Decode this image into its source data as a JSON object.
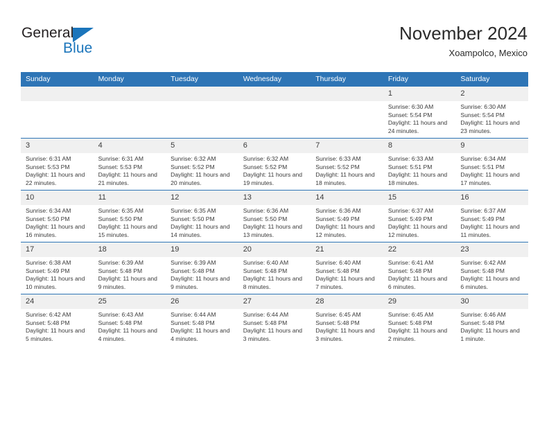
{
  "brand": {
    "name_top": "General",
    "name_bottom": "Blue",
    "accent_color": "#1b75bb"
  },
  "header": {
    "title": "November 2024",
    "subtitle": "Xoampolco, Mexico"
  },
  "theme": {
    "header_blue": "#2e75b6",
    "daynum_band": "#f0f0f0",
    "text": "#3b3b3b"
  },
  "calendar": {
    "weekday_headers": [
      "Sunday",
      "Monday",
      "Tuesday",
      "Wednesday",
      "Thursday",
      "Friday",
      "Saturday"
    ],
    "weeks": [
      [
        {
          "day": "",
          "empty": true
        },
        {
          "day": "",
          "empty": true
        },
        {
          "day": "",
          "empty": true
        },
        {
          "day": "",
          "empty": true
        },
        {
          "day": "",
          "empty": true
        },
        {
          "day": "1",
          "sunrise": "Sunrise: 6:30 AM",
          "sunset": "Sunset: 5:54 PM",
          "daylight": "Daylight: 11 hours and 24 minutes."
        },
        {
          "day": "2",
          "sunrise": "Sunrise: 6:30 AM",
          "sunset": "Sunset: 5:54 PM",
          "daylight": "Daylight: 11 hours and 23 minutes."
        }
      ],
      [
        {
          "day": "3",
          "sunrise": "Sunrise: 6:31 AM",
          "sunset": "Sunset: 5:53 PM",
          "daylight": "Daylight: 11 hours and 22 minutes."
        },
        {
          "day": "4",
          "sunrise": "Sunrise: 6:31 AM",
          "sunset": "Sunset: 5:53 PM",
          "daylight": "Daylight: 11 hours and 21 minutes."
        },
        {
          "day": "5",
          "sunrise": "Sunrise: 6:32 AM",
          "sunset": "Sunset: 5:52 PM",
          "daylight": "Daylight: 11 hours and 20 minutes."
        },
        {
          "day": "6",
          "sunrise": "Sunrise: 6:32 AM",
          "sunset": "Sunset: 5:52 PM",
          "daylight": "Daylight: 11 hours and 19 minutes."
        },
        {
          "day": "7",
          "sunrise": "Sunrise: 6:33 AM",
          "sunset": "Sunset: 5:52 PM",
          "daylight": "Daylight: 11 hours and 18 minutes."
        },
        {
          "day": "8",
          "sunrise": "Sunrise: 6:33 AM",
          "sunset": "Sunset: 5:51 PM",
          "daylight": "Daylight: 11 hours and 18 minutes."
        },
        {
          "day": "9",
          "sunrise": "Sunrise: 6:34 AM",
          "sunset": "Sunset: 5:51 PM",
          "daylight": "Daylight: 11 hours and 17 minutes."
        }
      ],
      [
        {
          "day": "10",
          "sunrise": "Sunrise: 6:34 AM",
          "sunset": "Sunset: 5:50 PM",
          "daylight": "Daylight: 11 hours and 16 minutes."
        },
        {
          "day": "11",
          "sunrise": "Sunrise: 6:35 AM",
          "sunset": "Sunset: 5:50 PM",
          "daylight": "Daylight: 11 hours and 15 minutes."
        },
        {
          "day": "12",
          "sunrise": "Sunrise: 6:35 AM",
          "sunset": "Sunset: 5:50 PM",
          "daylight": "Daylight: 11 hours and 14 minutes."
        },
        {
          "day": "13",
          "sunrise": "Sunrise: 6:36 AM",
          "sunset": "Sunset: 5:50 PM",
          "daylight": "Daylight: 11 hours and 13 minutes."
        },
        {
          "day": "14",
          "sunrise": "Sunrise: 6:36 AM",
          "sunset": "Sunset: 5:49 PM",
          "daylight": "Daylight: 11 hours and 12 minutes."
        },
        {
          "day": "15",
          "sunrise": "Sunrise: 6:37 AM",
          "sunset": "Sunset: 5:49 PM",
          "daylight": "Daylight: 11 hours and 12 minutes."
        },
        {
          "day": "16",
          "sunrise": "Sunrise: 6:37 AM",
          "sunset": "Sunset: 5:49 PM",
          "daylight": "Daylight: 11 hours and 11 minutes."
        }
      ],
      [
        {
          "day": "17",
          "sunrise": "Sunrise: 6:38 AM",
          "sunset": "Sunset: 5:49 PM",
          "daylight": "Daylight: 11 hours and 10 minutes."
        },
        {
          "day": "18",
          "sunrise": "Sunrise: 6:39 AM",
          "sunset": "Sunset: 5:48 PM",
          "daylight": "Daylight: 11 hours and 9 minutes."
        },
        {
          "day": "19",
          "sunrise": "Sunrise: 6:39 AM",
          "sunset": "Sunset: 5:48 PM",
          "daylight": "Daylight: 11 hours and 9 minutes."
        },
        {
          "day": "20",
          "sunrise": "Sunrise: 6:40 AM",
          "sunset": "Sunset: 5:48 PM",
          "daylight": "Daylight: 11 hours and 8 minutes."
        },
        {
          "day": "21",
          "sunrise": "Sunrise: 6:40 AM",
          "sunset": "Sunset: 5:48 PM",
          "daylight": "Daylight: 11 hours and 7 minutes."
        },
        {
          "day": "22",
          "sunrise": "Sunrise: 6:41 AM",
          "sunset": "Sunset: 5:48 PM",
          "daylight": "Daylight: 11 hours and 6 minutes."
        },
        {
          "day": "23",
          "sunrise": "Sunrise: 6:42 AM",
          "sunset": "Sunset: 5:48 PM",
          "daylight": "Daylight: 11 hours and 6 minutes."
        }
      ],
      [
        {
          "day": "24",
          "sunrise": "Sunrise: 6:42 AM",
          "sunset": "Sunset: 5:48 PM",
          "daylight": "Daylight: 11 hours and 5 minutes."
        },
        {
          "day": "25",
          "sunrise": "Sunrise: 6:43 AM",
          "sunset": "Sunset: 5:48 PM",
          "daylight": "Daylight: 11 hours and 4 minutes."
        },
        {
          "day": "26",
          "sunrise": "Sunrise: 6:44 AM",
          "sunset": "Sunset: 5:48 PM",
          "daylight": "Daylight: 11 hours and 4 minutes."
        },
        {
          "day": "27",
          "sunrise": "Sunrise: 6:44 AM",
          "sunset": "Sunset: 5:48 PM",
          "daylight": "Daylight: 11 hours and 3 minutes."
        },
        {
          "day": "28",
          "sunrise": "Sunrise: 6:45 AM",
          "sunset": "Sunset: 5:48 PM",
          "daylight": "Daylight: 11 hours and 3 minutes."
        },
        {
          "day": "29",
          "sunrise": "Sunrise: 6:45 AM",
          "sunset": "Sunset: 5:48 PM",
          "daylight": "Daylight: 11 hours and 2 minutes."
        },
        {
          "day": "30",
          "sunrise": "Sunrise: 6:46 AM",
          "sunset": "Sunset: 5:48 PM",
          "daylight": "Daylight: 11 hours and 1 minute."
        }
      ]
    ]
  }
}
